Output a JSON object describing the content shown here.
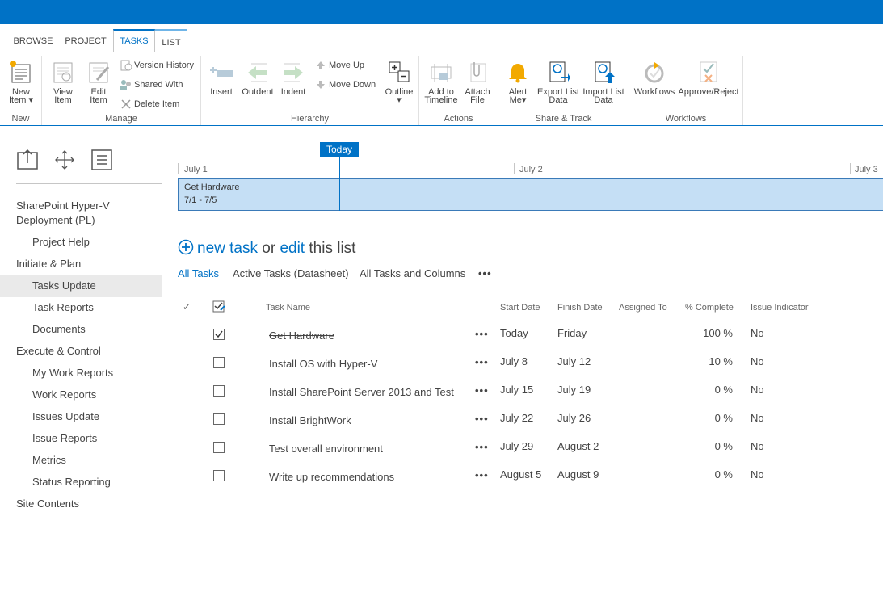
{
  "ribbon": {
    "tabs": [
      {
        "label": "BROWSE"
      },
      {
        "label": "PROJECT"
      },
      {
        "label": "TASKS"
      },
      {
        "label": "LIST"
      }
    ],
    "active_tab": "TASKS",
    "groups": {
      "new": {
        "label": "New",
        "new_item_line1": "New",
        "new_item_line2": "Item"
      },
      "manage": {
        "label": "Manage",
        "view_item_line1": "View",
        "view_item_line2": "Item",
        "edit_item_line1": "Edit",
        "edit_item_line2": "Item",
        "version_history": "Version History",
        "shared_with": "Shared With",
        "delete_item": "Delete Item"
      },
      "hierarchy": {
        "label": "Hierarchy",
        "insert": "Insert",
        "outdent": "Outdent",
        "indent": "Indent",
        "move_up": "Move Up",
        "move_down": "Move Down",
        "outline": "Outline"
      },
      "actions": {
        "label": "Actions",
        "add_timeline_line1": "Add to",
        "add_timeline_line2": "Timeline",
        "attach_line1": "Attach",
        "attach_line2": "File"
      },
      "share_track": {
        "label": "Share & Track",
        "alert_line1": "Alert",
        "alert_line2": "Me",
        "export_line1": "Export List",
        "export_line2": "Data",
        "import_line1": "Import List",
        "import_line2": "Data"
      },
      "workflows": {
        "label": "Workflows",
        "workflows": "Workflows",
        "approve_reject": "Approve/Reject"
      }
    }
  },
  "leftnav": {
    "items": [
      {
        "label": "SharePoint Hyper-V Deployment (PL)",
        "level": 0
      },
      {
        "label": "Project Help",
        "level": 1
      },
      {
        "label": "Initiate & Plan",
        "level": 0
      },
      {
        "label": "Tasks Update",
        "level": 1,
        "selected": true
      },
      {
        "label": "Task Reports",
        "level": 1
      },
      {
        "label": "Documents",
        "level": 1
      },
      {
        "label": "Execute & Control",
        "level": 0
      },
      {
        "label": "My Work Reports",
        "level": 1
      },
      {
        "label": "Work Reports",
        "level": 1
      },
      {
        "label": "Issues Update",
        "level": 1
      },
      {
        "label": "Issue Reports",
        "level": 1
      },
      {
        "label": "Metrics",
        "level": 1
      },
      {
        "label": "Status Reporting",
        "level": 1
      },
      {
        "label": "Site Contents",
        "level": 0
      }
    ]
  },
  "timeline": {
    "today_label": "Today",
    "dates": [
      "July 1",
      "July 2",
      "July 3"
    ],
    "bar_title": "Get Hardware",
    "bar_range": "7/1 - 7/5"
  },
  "newtask": {
    "new_task": "new task",
    "or": "or",
    "edit": "edit",
    "this_list": "this list"
  },
  "views": {
    "items": [
      "All Tasks",
      "Active Tasks (Datasheet)",
      "All Tasks and Columns"
    ],
    "more": "•••"
  },
  "table": {
    "headers": {
      "check": "✓",
      "task_name": "Task Name",
      "start_date": "Start Date",
      "finish_date": "Finish Date",
      "assigned_to": "Assigned To",
      "percent_complete": "% Complete",
      "issue_indicator": "Issue Indicator"
    },
    "rows": [
      {
        "name": "Get Hardware",
        "start": "Today",
        "finish": "Friday",
        "assigned": "",
        "pct": "100 %",
        "issue": "No",
        "done": true
      },
      {
        "name": "Install OS with Hyper-V",
        "start": "July 8",
        "finish": "July 12",
        "assigned": "",
        "pct": "10 %",
        "issue": "No",
        "done": false
      },
      {
        "name": "Install SharePoint Server 2013 and Test",
        "start": "July 15",
        "finish": "July 19",
        "assigned": "",
        "pct": "0 %",
        "issue": "No",
        "done": false
      },
      {
        "name": "Install BrightWork",
        "start": "July 22",
        "finish": "July 26",
        "assigned": "",
        "pct": "0 %",
        "issue": "No",
        "done": false
      },
      {
        "name": "Test overall environment",
        "start": "July 29",
        "finish": "August 2",
        "assigned": "",
        "pct": "0 %",
        "issue": "No",
        "done": false
      },
      {
        "name": "Write up recommendations",
        "start": "August 5",
        "finish": "August 9",
        "assigned": "",
        "pct": "0 %",
        "issue": "No",
        "done": false
      }
    ],
    "row_menu": "•••"
  },
  "colors": {
    "brand": "#0072c6",
    "timeline_bar": "#c5dff5",
    "selected_nav": "#eaeaea"
  }
}
